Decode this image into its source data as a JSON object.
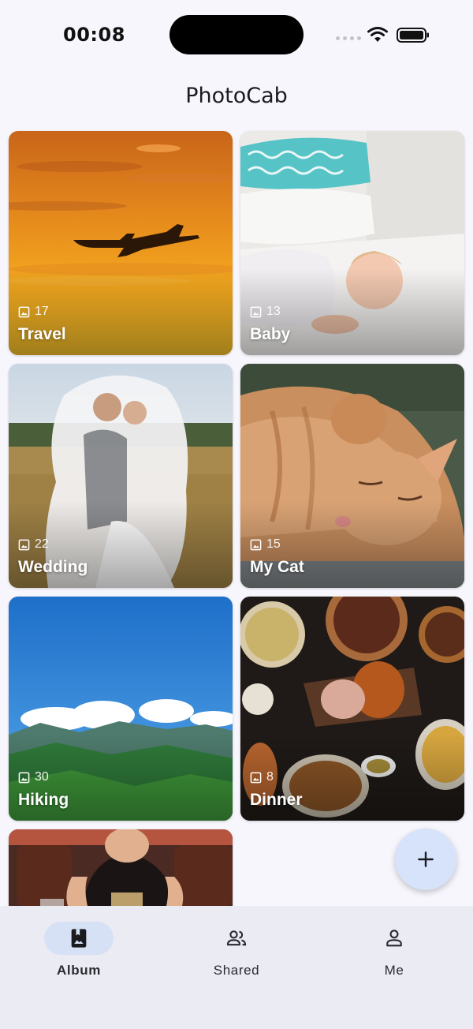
{
  "status": {
    "time": "00:08"
  },
  "header": {
    "title": "PhotoCab"
  },
  "albums": [
    {
      "name": "Travel",
      "count": "17"
    },
    {
      "name": "Baby",
      "count": "13"
    },
    {
      "name": "Wedding",
      "count": "22"
    },
    {
      "name": "My Cat",
      "count": "15"
    },
    {
      "name": "Hiking",
      "count": "30"
    },
    {
      "name": "Dinner",
      "count": "8"
    }
  ],
  "fab": {
    "icon": "plus-icon"
  },
  "nav": {
    "items": [
      {
        "label": "Album",
        "icon": "album-icon"
      },
      {
        "label": "Shared",
        "icon": "people-icon"
      },
      {
        "label": "Me",
        "icon": "person-icon"
      }
    ],
    "active": "Album"
  },
  "colors": {
    "accent": "#d6e1f6",
    "fab": "#d6e3fb",
    "nav_bg": "#ebebf3",
    "background": "#f7f6fd"
  }
}
